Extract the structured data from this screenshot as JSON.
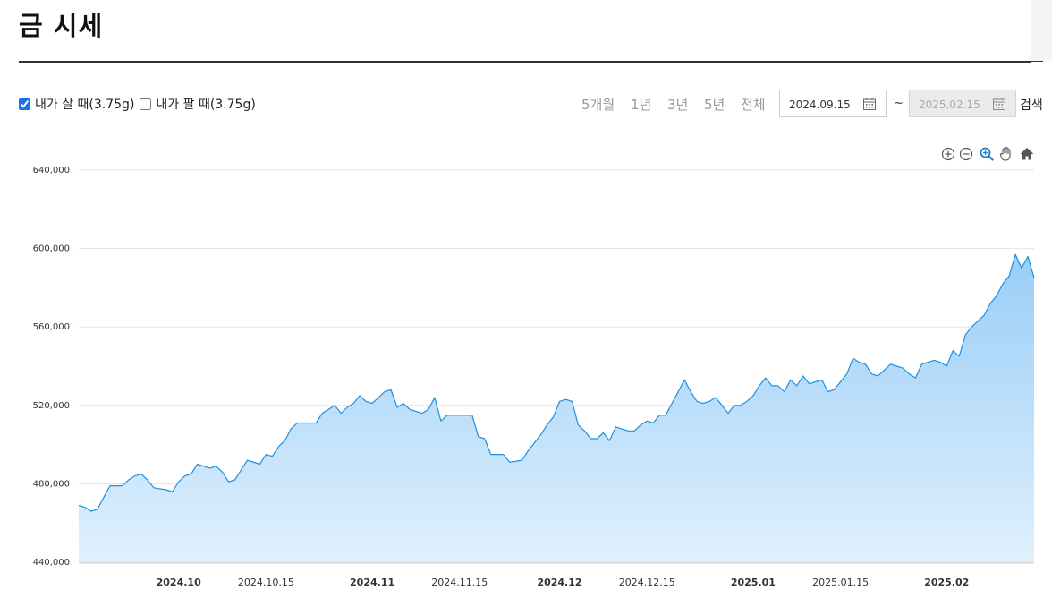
{
  "header": {
    "title": "금 시세"
  },
  "filters": {
    "buy_label": "내가 살 때(3.75g)",
    "buy_checked": true,
    "sell_label": "내가 팔 때(3.75g)",
    "sell_checked": false
  },
  "periods": [
    "5개월",
    "1년",
    "3년",
    "5년",
    "전체"
  ],
  "active_period": "5개월",
  "date_range": {
    "start": "2024.09.15",
    "separator": "~",
    "end": "2025.02.15",
    "search_label": "검색"
  },
  "toolbar_icons": [
    "zoom-in-icon",
    "zoom-out-icon",
    "magnifier-icon",
    "pan-hand-icon",
    "home-icon"
  ],
  "colors": {
    "line": "#1e90e0",
    "fill_top": "#99cdf7",
    "fill_bottom": "#e0f0fd",
    "grid": "#e3e3e3"
  },
  "chart_data": {
    "type": "area",
    "title": "",
    "xlabel": "",
    "ylabel": "",
    "ylim": [
      440000,
      640000
    ],
    "yticks": [
      440000,
      480000,
      520000,
      560000,
      600000,
      640000
    ],
    "ytick_labels": [
      "440,000",
      "480,000",
      "520,000",
      "560,000",
      "600,000",
      "640,000"
    ],
    "xlim": [
      "2024-09-15",
      "2025-02-15"
    ],
    "xticks": [
      {
        "date": "2024-10-01",
        "label": "2024.10",
        "major": true
      },
      {
        "date": "2024-10-15",
        "label": "2024.10.15",
        "major": false
      },
      {
        "date": "2024-11-01",
        "label": "2024.11",
        "major": true
      },
      {
        "date": "2024-11-15",
        "label": "2024.11.15",
        "major": false
      },
      {
        "date": "2024-12-01",
        "label": "2024.12",
        "major": true
      },
      {
        "date": "2024-12-15",
        "label": "2024.12.15",
        "major": false
      },
      {
        "date": "2025-01-01",
        "label": "2025.01",
        "major": true
      },
      {
        "date": "2025-01-15",
        "label": "2025.01.15",
        "major": false
      },
      {
        "date": "2025-02-01",
        "label": "2025.02",
        "major": true
      }
    ],
    "grid": true,
    "legend": "none",
    "series": [
      {
        "values": [
          [
            "2024-09-15",
            469000
          ],
          [
            "2024-09-16",
            468000
          ],
          [
            "2024-09-17",
            466000
          ],
          [
            "2024-09-18",
            467000
          ],
          [
            "2024-09-19",
            473000
          ],
          [
            "2024-09-20",
            479000
          ],
          [
            "2024-09-22",
            479000
          ],
          [
            "2024-09-23",
            482000
          ],
          [
            "2024-09-24",
            484000
          ],
          [
            "2024-09-25",
            485000
          ],
          [
            "2024-09-26",
            482000
          ],
          [
            "2024-09-27",
            478000
          ],
          [
            "2024-09-29",
            477000
          ],
          [
            "2024-09-30",
            476000
          ],
          [
            "2024-10-01",
            481000
          ],
          [
            "2024-10-02",
            484000
          ],
          [
            "2024-10-03",
            485000
          ],
          [
            "2024-10-04",
            490000
          ],
          [
            "2024-10-05",
            489000
          ],
          [
            "2024-10-06",
            488000
          ],
          [
            "2024-10-07",
            489000
          ],
          [
            "2024-10-08",
            486000
          ],
          [
            "2024-10-09",
            481000
          ],
          [
            "2024-10-10",
            482000
          ],
          [
            "2024-10-11",
            487000
          ],
          [
            "2024-10-12",
            492000
          ],
          [
            "2024-10-14",
            490000
          ],
          [
            "2024-10-15",
            495000
          ],
          [
            "2024-10-16",
            494000
          ],
          [
            "2024-10-17",
            499000
          ],
          [
            "2024-10-18",
            502000
          ],
          [
            "2024-10-19",
            508000
          ],
          [
            "2024-10-20",
            511000
          ],
          [
            "2024-10-21",
            511000
          ],
          [
            "2024-10-23",
            511000
          ],
          [
            "2024-10-24",
            516000
          ],
          [
            "2024-10-25",
            518000
          ],
          [
            "2024-10-26",
            520000
          ],
          [
            "2024-10-27",
            516000
          ],
          [
            "2024-10-28",
            519000
          ],
          [
            "2024-10-29",
            521000
          ],
          [
            "2024-10-30",
            525000
          ],
          [
            "2024-10-31",
            522000
          ],
          [
            "2024-11-01",
            521000
          ],
          [
            "2024-11-03",
            527000
          ],
          [
            "2024-11-04",
            528000
          ],
          [
            "2024-11-05",
            519000
          ],
          [
            "2024-11-06",
            521000
          ],
          [
            "2024-11-07",
            518000
          ],
          [
            "2024-11-08",
            517000
          ],
          [
            "2024-11-09",
            516000
          ],
          [
            "2024-11-10",
            518000
          ],
          [
            "2024-11-11",
            524000
          ],
          [
            "2024-11-12",
            512000
          ],
          [
            "2024-11-13",
            515000
          ],
          [
            "2024-11-14",
            515000
          ],
          [
            "2024-11-17",
            515000
          ],
          [
            "2024-11-18",
            504000
          ],
          [
            "2024-11-19",
            503000
          ],
          [
            "2024-11-20",
            495000
          ],
          [
            "2024-11-22",
            495000
          ],
          [
            "2024-11-23",
            491000
          ],
          [
            "2024-11-25",
            492000
          ],
          [
            "2024-11-26",
            497000
          ],
          [
            "2024-11-27",
            501000
          ],
          [
            "2024-11-28",
            505000
          ],
          [
            "2024-11-29",
            510000
          ],
          [
            "2024-11-30",
            514000
          ],
          [
            "2024-12-01",
            522000
          ],
          [
            "2024-12-02",
            523000
          ],
          [
            "2024-12-03",
            522000
          ],
          [
            "2024-12-04",
            510000
          ],
          [
            "2024-12-05",
            507000
          ],
          [
            "2024-12-06",
            503000
          ],
          [
            "2024-12-07",
            503000
          ],
          [
            "2024-12-08",
            506000
          ],
          [
            "2024-12-09",
            502000
          ],
          [
            "2024-12-10",
            509000
          ],
          [
            "2024-12-12",
            507000
          ],
          [
            "2024-12-13",
            507000
          ],
          [
            "2024-12-14",
            510000
          ],
          [
            "2024-12-15",
            512000
          ],
          [
            "2024-12-16",
            511000
          ],
          [
            "2024-12-17",
            515000
          ],
          [
            "2024-12-18",
            515000
          ],
          [
            "2024-12-19",
            521000
          ],
          [
            "2024-12-20",
            527000
          ],
          [
            "2024-12-21",
            533000
          ],
          [
            "2024-12-22",
            527000
          ],
          [
            "2024-12-23",
            522000
          ],
          [
            "2024-12-24",
            521000
          ],
          [
            "2024-12-25",
            522000
          ],
          [
            "2024-12-26",
            524000
          ],
          [
            "2024-12-27",
            520000
          ],
          [
            "2024-12-28",
            516000
          ],
          [
            "2024-12-29",
            520000
          ],
          [
            "2024-12-30",
            520000
          ],
          [
            "2024-12-31",
            522000
          ],
          [
            "2025-01-01",
            525000
          ],
          [
            "2025-01-02",
            530000
          ],
          [
            "2025-01-03",
            534000
          ],
          [
            "2025-01-04",
            530000
          ],
          [
            "2025-01-05",
            530000
          ],
          [
            "2025-01-06",
            527000
          ],
          [
            "2025-01-07",
            533000
          ],
          [
            "2025-01-08",
            530000
          ],
          [
            "2025-01-09",
            535000
          ],
          [
            "2025-01-10",
            531000
          ],
          [
            "2025-01-11",
            532000
          ],
          [
            "2025-01-12",
            533000
          ],
          [
            "2025-01-13",
            527000
          ],
          [
            "2025-01-14",
            528000
          ],
          [
            "2025-01-15",
            532000
          ],
          [
            "2025-01-16",
            536000
          ],
          [
            "2025-01-17",
            544000
          ],
          [
            "2025-01-18",
            542000
          ],
          [
            "2025-01-19",
            541000
          ],
          [
            "2025-01-20",
            536000
          ],
          [
            "2025-01-21",
            535000
          ],
          [
            "2025-01-22",
            538000
          ],
          [
            "2025-01-23",
            541000
          ],
          [
            "2025-01-24",
            540000
          ],
          [
            "2025-01-25",
            539000
          ],
          [
            "2025-01-26",
            536000
          ],
          [
            "2025-01-27",
            534000
          ],
          [
            "2025-01-28",
            541000
          ],
          [
            "2025-01-29",
            542000
          ],
          [
            "2025-01-30",
            543000
          ],
          [
            "2025-01-31",
            542000
          ],
          [
            "2025-02-01",
            540000
          ],
          [
            "2025-02-02",
            548000
          ],
          [
            "2025-02-03",
            545000
          ],
          [
            "2025-02-04",
            556000
          ],
          [
            "2025-02-05",
            560000
          ],
          [
            "2025-02-06",
            563000
          ],
          [
            "2025-02-07",
            566000
          ],
          [
            "2025-02-08",
            572000
          ],
          [
            "2025-02-09",
            576000
          ],
          [
            "2025-02-10",
            582000
          ],
          [
            "2025-02-11",
            586000
          ],
          [
            "2025-02-12",
            597000
          ],
          [
            "2025-02-13",
            590000
          ],
          [
            "2025-02-14",
            596000
          ],
          [
            "2025-02-15",
            585000
          ]
        ]
      }
    ]
  }
}
